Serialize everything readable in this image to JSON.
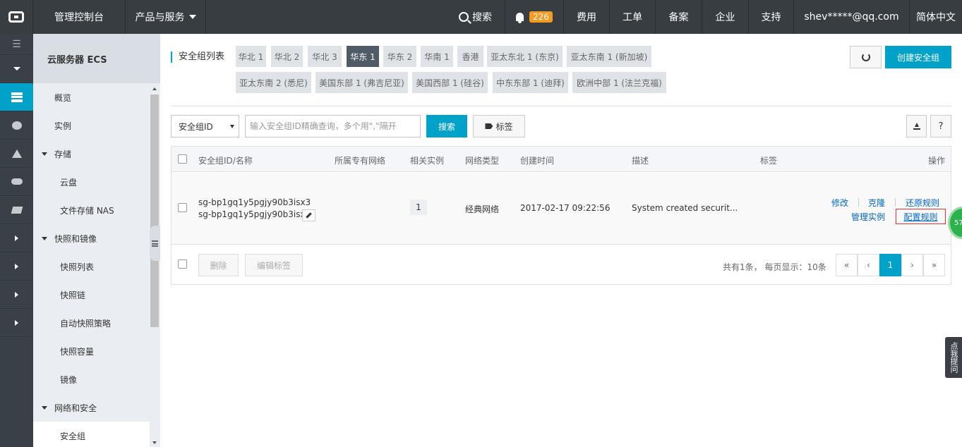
{
  "topbar": {
    "console": "管理控制台",
    "products": "产品与服务",
    "search": "搜索",
    "notify_count": "226",
    "fee": "费用",
    "order": "工单",
    "beian": "备案",
    "enterprise": "企业",
    "support": "支持",
    "user": "shev*****@qq.com",
    "lang": "简体中文"
  },
  "sidebar": {
    "title": "云服务器 ECS",
    "items": [
      {
        "label": "概览",
        "level": "l1"
      },
      {
        "label": "实例",
        "level": "l1"
      },
      {
        "label": "存储",
        "level": "group"
      },
      {
        "label": "云盘",
        "level": "l2"
      },
      {
        "label": "文件存储 NAS",
        "level": "l2"
      },
      {
        "label": "快照和镜像",
        "level": "group"
      },
      {
        "label": "快照列表",
        "level": "l2"
      },
      {
        "label": "快照链",
        "level": "l2"
      },
      {
        "label": "自动快照策略",
        "level": "l2"
      },
      {
        "label": "快照容量",
        "level": "l2"
      },
      {
        "label": "镜像",
        "level": "l2"
      },
      {
        "label": "网络和安全",
        "level": "group"
      },
      {
        "label": "安全组",
        "level": "l2"
      }
    ]
  },
  "page": {
    "title": "安全组列表",
    "regions": [
      "华北 1",
      "华北 2",
      "华北 3",
      "华东 1",
      "华东 2",
      "华南 1",
      "香港",
      "亚太东北 1 (东京)",
      "亚太东南 1 (新加坡)",
      "亚太东南 2 (悉尼)",
      "美国东部 1 (弗吉尼亚)",
      "美国西部 1 (硅谷)",
      "中东东部 1 (迪拜)",
      "欧洲中部 1 (法兰克福)"
    ],
    "active_region": "华东 1",
    "create_button": "创建安全组"
  },
  "filter": {
    "field": "安全组ID",
    "placeholder": "输入安全组ID精确查询，多个用\",\"隔开",
    "search_button": "搜索",
    "tag_button": "标签",
    "help_button": "?"
  },
  "table": {
    "headers": {
      "id_name": "安全组ID/名称",
      "vpc": "所属专有网络",
      "instances": "相关实例",
      "net_type": "网络类型",
      "created": "创建时间",
      "desc": "描述",
      "tags": "标签",
      "ops": "操作"
    },
    "rows": [
      {
        "id": "sg-bp1gq1y5pgjy90b3isx3",
        "name": "sg-bp1gq1y5pgjy90b3isx...",
        "instances": "1",
        "net_type": "经典网络",
        "created": "2017-02-17 09:22:56",
        "desc": "System created securit...",
        "ops": {
          "modify": "修改",
          "clone": "克隆",
          "restore": "还原规则",
          "manage": "管理实例",
          "config": "配置规则"
        }
      }
    ],
    "footer": {
      "delete": "删除",
      "edit_tags": "编辑标签",
      "summary": "共有1条， 每页显示：10条",
      "pages": [
        "«",
        "‹",
        "1",
        "›",
        "»"
      ],
      "current_page": "1"
    }
  },
  "floats": {
    "green_badge": "57",
    "help_tab": "点我提问"
  }
}
